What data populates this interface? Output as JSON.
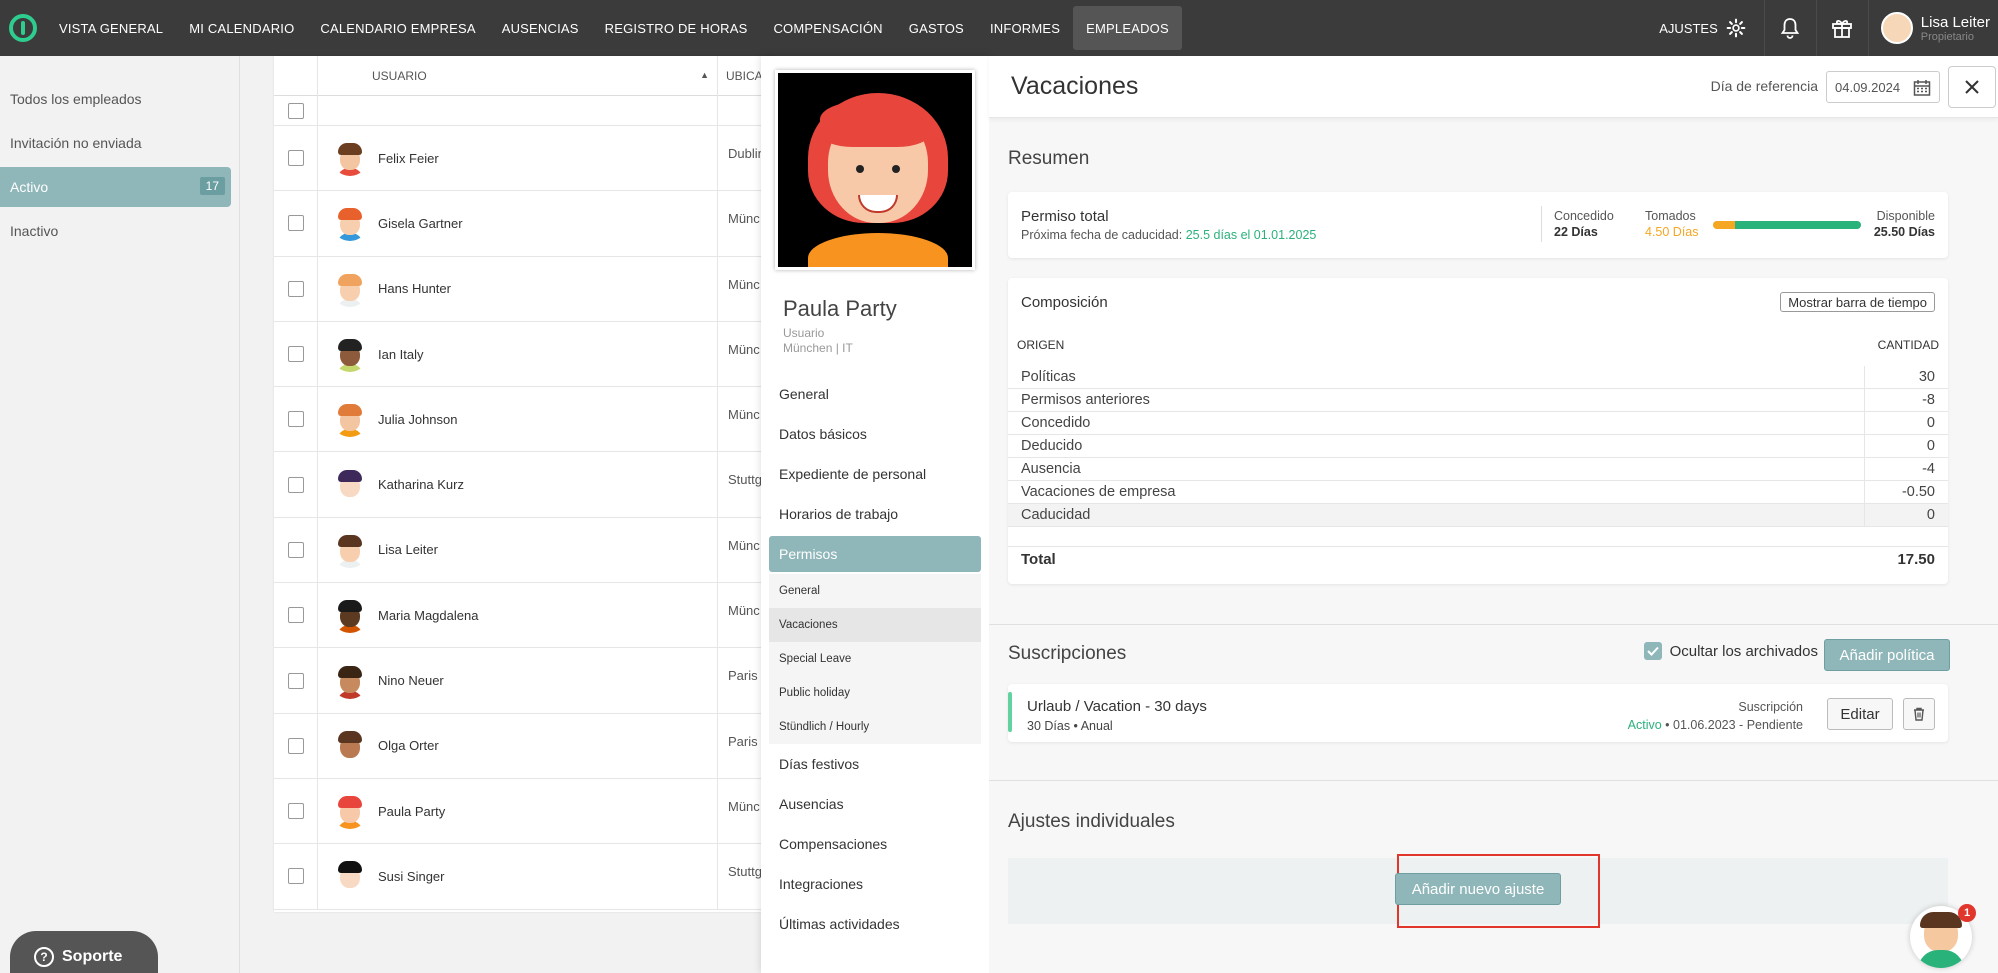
{
  "nav": {
    "items": [
      "VISTA GENERAL",
      "MI CALENDARIO",
      "CALENDARIO EMPRESA",
      "AUSENCIAS",
      "REGISTRO DE HORAS",
      "COMPENSACIÓN",
      "GASTOS",
      "INFORMES",
      "EMPLEADOS"
    ],
    "active": "EMPLEADOS",
    "settings_label": "AJUSTES",
    "user_name": "Lisa Leiter",
    "user_role": "Propietario"
  },
  "sidebar": {
    "items": [
      {
        "label": "Todos los empleados"
      },
      {
        "label": "Invitación no enviada"
      },
      {
        "label": "Activo",
        "count": "17"
      },
      {
        "label": "Inactivo"
      }
    ],
    "support_label": "Soporte"
  },
  "table": {
    "col_user": "USUARIO",
    "col_location": "UBICA",
    "rows": [
      {
        "name": "Felix Feier",
        "location": "Dublin",
        "skin": "#f3c5a0",
        "hair": "#6b3e1f",
        "shirt": "#e74c3c"
      },
      {
        "name": "Gisela Gartner",
        "location": "Münc",
        "skin": "#f7cfae",
        "hair": "#e8612c",
        "shirt": "#3498db"
      },
      {
        "name": "Hans Hunter",
        "location": "Münc",
        "skin": "#f7cfae",
        "hair": "#f0a35e",
        "shirt": "#ecf0f1"
      },
      {
        "name": "Ian Italy",
        "location": "Münc",
        "skin": "#8d5a3b",
        "hair": "#222222",
        "shirt": "#c5d86d"
      },
      {
        "name": "Julia Johnson",
        "location": "Münc",
        "skin": "#f3c5a0",
        "hair": "#e07b39",
        "shirt": "#f39c12"
      },
      {
        "name": "Katharina Kurz",
        "location": "Stuttg",
        "skin": "#f7d9c4",
        "hair": "#3d2a5a",
        "shirt": "#ffffff"
      },
      {
        "name": "Lisa Leiter",
        "location": "Münc",
        "skin": "#f7cfae",
        "hair": "#5a3520",
        "shirt": "#ecf0f1"
      },
      {
        "name": "Maria Magdalena",
        "location": "Münc",
        "skin": "#5c3a21",
        "hair": "#1a1a1a",
        "shirt": "#d35400"
      },
      {
        "name": "Nino Neuer",
        "location": "Paris",
        "skin": "#c68a5e",
        "hair": "#3a2414",
        "shirt": "#c0392b"
      },
      {
        "name": "Olga Orter",
        "location": "Paris",
        "skin": "#b97a52",
        "hair": "#5a3520",
        "shirt": "#ffffff"
      },
      {
        "name": "Paula Party",
        "location": "Münc",
        "skin": "#f7c9a8",
        "hair": "#e8453c",
        "shirt": "#f7931e"
      },
      {
        "name": "Susi Singer",
        "location": "Stuttg",
        "skin": "#f7d9c4",
        "hair": "#111111",
        "shirt": "#ffffff"
      }
    ]
  },
  "profile": {
    "name": "Paula Party",
    "role": "Usuario",
    "location": "München | IT",
    "menu": [
      "General",
      "Datos básicos",
      "Expediente de personal",
      "Horarios de trabajo",
      "Permisos"
    ],
    "submenu": [
      "General",
      "Vacaciones",
      "Special Leave",
      "Public holiday",
      "Stündlich / Hourly"
    ],
    "submenu_active": "Vacaciones",
    "menu_after": [
      "Días festivos",
      "Ausencias",
      "Compensaciones",
      "Integraciones",
      "Últimas actividades"
    ]
  },
  "detail": {
    "title": "Vacaciones",
    "ref_label": "Día de referencia",
    "ref_date": "04.09.2024",
    "summary": {
      "section": "Resumen",
      "title": "Permiso total",
      "expiry_label": "Próxima fecha de caducidad:",
      "expiry_value": "25.5 días el 01.01.2025",
      "granted_label": "Concedido",
      "granted_value": "22 Días",
      "taken_label": "Tomados",
      "taken_value": "4.50 Días",
      "available_label": "Disponible",
      "available_value": "25.50 Días",
      "taken_fraction": 0.15
    },
    "composition": {
      "title": "Composición",
      "timeline_button": "Mostrar barra de tiempo",
      "col_origin": "ORIGEN",
      "col_amount": "CANTIDAD",
      "rows": [
        {
          "label": "Políticas",
          "value": "30"
        },
        {
          "label": "Permisos anteriores",
          "value": "-8"
        },
        {
          "label": "Concedido",
          "value": "0"
        },
        {
          "label": "Deducido",
          "value": "0"
        },
        {
          "label": "Ausencia",
          "value": "-4"
        },
        {
          "label": "Vacaciones de empresa",
          "value": "-0.50"
        },
        {
          "label": "Caducidad",
          "value": "0"
        }
      ],
      "total_label": "Total",
      "total_value": "17.50"
    },
    "subscriptions": {
      "section": "Suscripciones",
      "hide_archived": "Ocultar los archivados",
      "add_policy": "Añadir política",
      "item_name": "Urlaub / Vacation - 30 days",
      "item_meta": "30 Días • Anual",
      "item_type": "Suscripción",
      "item_status": "Activo",
      "item_dates": "• 01.06.2023 - Pendiente",
      "edit": "Editar"
    },
    "individual": {
      "section": "Ajustes individuales",
      "add_button": "Añadir nuevo ajuste"
    }
  },
  "chat": {
    "badge": "1"
  }
}
